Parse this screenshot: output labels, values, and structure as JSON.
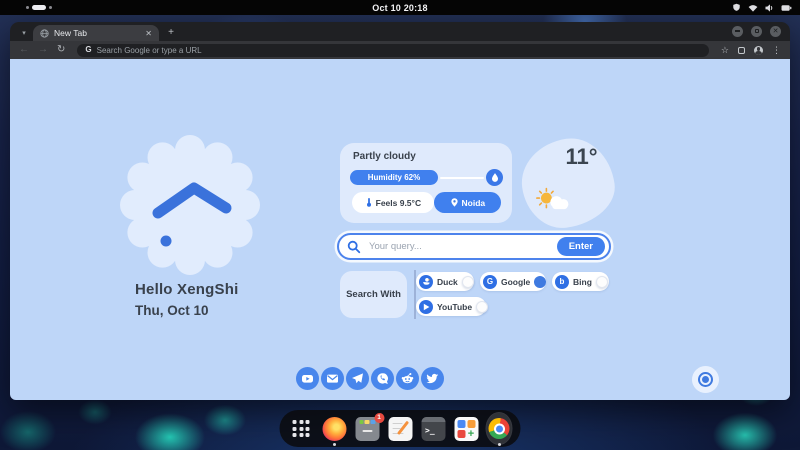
{
  "topbar": {
    "clock": "Oct 10 20:18",
    "status_icons": [
      "shield-icon",
      "wifi-icon",
      "volume-icon",
      "battery-icon"
    ]
  },
  "browser": {
    "tab_title": "New Tab",
    "url_placeholder": "Search Google or type a URL"
  },
  "page": {
    "greeting": "Hello XengShi",
    "date": "Thu, Oct 10",
    "weather": {
      "condition": "Partly cloudy",
      "humidity_label": "Humidity 62%",
      "humidity_percent": 62,
      "feels_label": "Feels 9.5°C",
      "location": "Noida",
      "temperature": "11°"
    },
    "search": {
      "placeholder": "Your query...",
      "enter_label": "Enter"
    },
    "search_with": {
      "label": "Search With",
      "engines": [
        {
          "name": "Duck",
          "selected": false
        },
        {
          "name": "Google",
          "selected": true
        },
        {
          "name": "Bing",
          "selected": false
        },
        {
          "name": "YouTube",
          "selected": false
        }
      ]
    },
    "social": {
      "items": [
        "YouTube",
        "Email",
        "Telegram",
        "WhatsApp",
        "Reddit",
        "Twitter"
      ]
    }
  },
  "dock": {
    "badge_count": "1",
    "items": [
      "app-grid",
      "firefox",
      "file-box",
      "text-editor",
      "terminal",
      "app-store",
      "chrome"
    ]
  },
  "colors": {
    "accent": "#4080ee",
    "page_bg": "#bed6f8",
    "card_bg": "#dfeafc",
    "text_dark": "#39414c"
  }
}
